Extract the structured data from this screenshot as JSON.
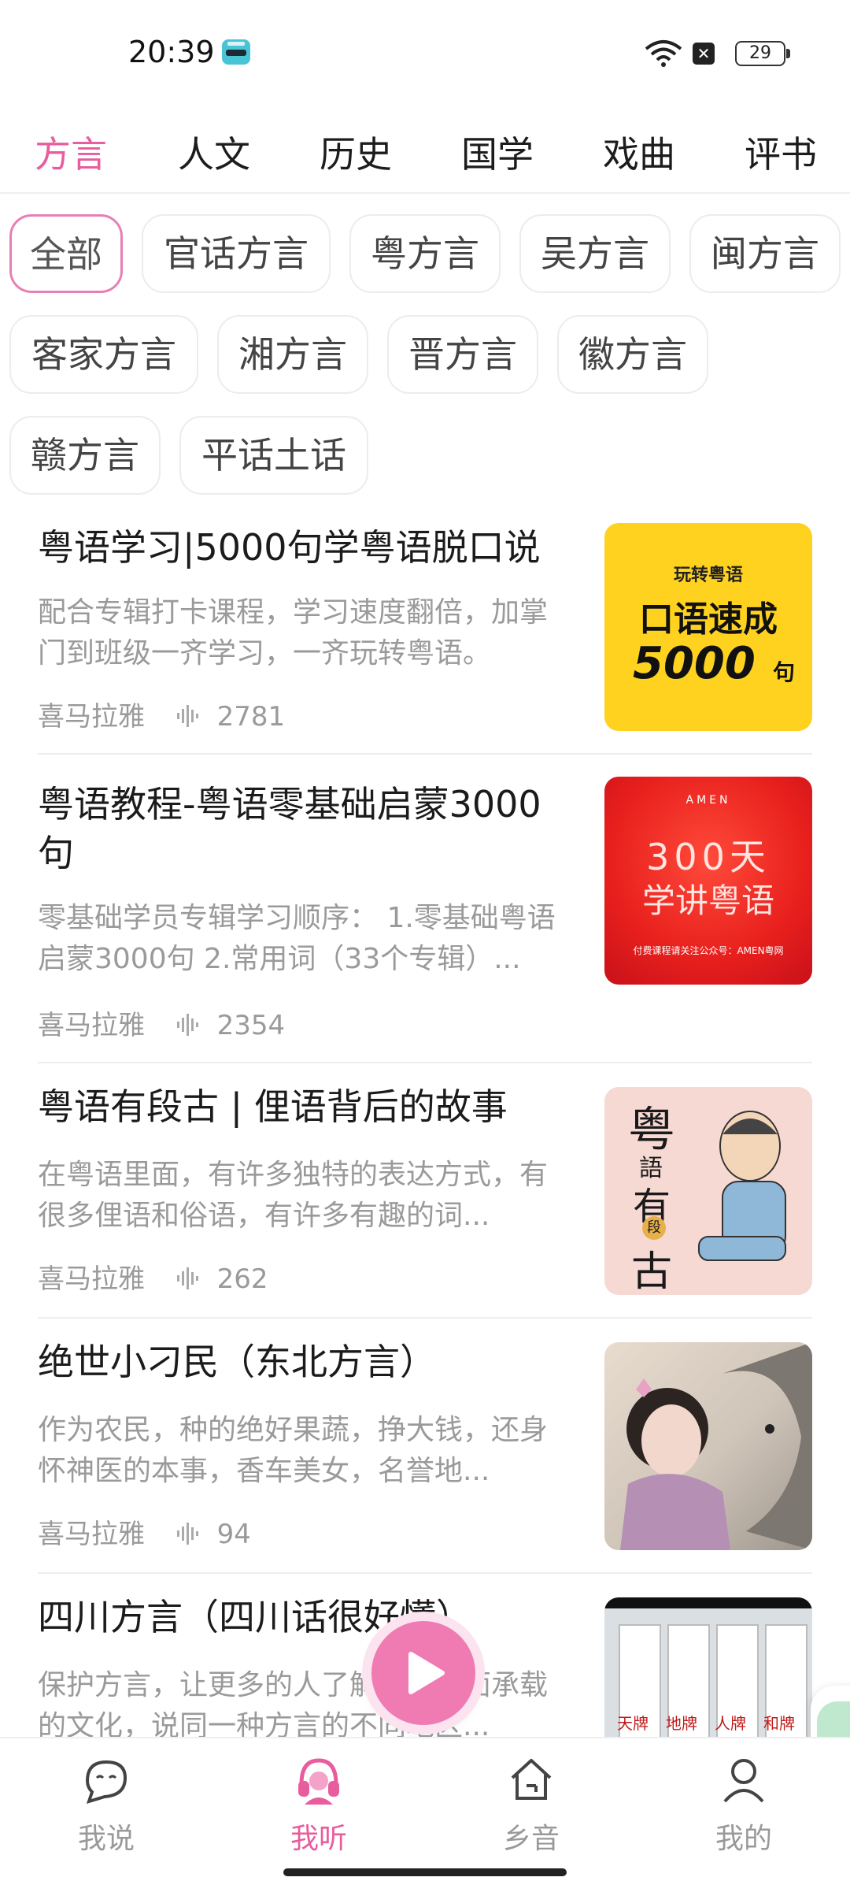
{
  "status_bar": {
    "time": "20:39",
    "battery": "29"
  },
  "tabs": [
    {
      "label": "方言",
      "active": true
    },
    {
      "label": "人文"
    },
    {
      "label": "历史"
    },
    {
      "label": "国学"
    },
    {
      "label": "戏曲"
    },
    {
      "label": "评书"
    }
  ],
  "filters": [
    {
      "label": "全部",
      "active": true
    },
    {
      "label": "官话方言"
    },
    {
      "label": "粤方言"
    },
    {
      "label": "吴方言"
    },
    {
      "label": "闽方言"
    },
    {
      "label": "客家方言"
    },
    {
      "label": "湘方言"
    },
    {
      "label": "晋方言"
    },
    {
      "label": "徽方言"
    },
    {
      "label": "赣方言"
    },
    {
      "label": "平话土话"
    }
  ],
  "items": [
    {
      "title": "粤语学习|5000句学粤语脱口说",
      "desc": "配合专辑打卡课程，学习速度翻倍，加掌门到班级一齐学习，一齐玩转粤语。",
      "source": "喜马拉雅",
      "plays": "2781",
      "cover": {
        "top": "玩转粤语",
        "main": "口语速成",
        "num": "5000",
        "unit": "句"
      }
    },
    {
      "title": "粤语教程-粤语零基础启蒙3000句",
      "desc": "零基础学员专辑学习顺序： 1.零基础粤语启蒙3000句 2.常用词（33个专辑）...",
      "source": "喜马拉雅",
      "plays": "2354",
      "cover": {
        "top": "AMEN",
        "line1": "300天",
        "line2": "学讲粤语",
        "foot": "付费课程请关注公众号：AMEN粤网"
      }
    },
    {
      "title": "粤语有段古 | 俚语背后的故事",
      "desc": "在粤语里面，有许多独特的表达方式，有很多俚语和俗语，有许多有趣的词...",
      "source": "喜马拉雅",
      "plays": "262",
      "cover": {
        "c1": "粤",
        "c2": "語",
        "c3": "有",
        "c4": "段",
        "c5": "古"
      }
    },
    {
      "title": "绝世小刁民（东北方言）",
      "desc": "作为农民，种的绝好果蔬，挣大钱，还身怀神医的本事，香车美女，名誉地...",
      "source": "喜马拉雅",
      "plays": "94"
    },
    {
      "title": "四川方言（四川话很好懂）",
      "desc": "保护方言，让更多的人了解方言里面承载的文化，说同一种方言的不同地区...",
      "cover": {
        "t1": "天牌",
        "t2": "地牌",
        "t3": "人牌",
        "t4": "和牌"
      }
    }
  ],
  "bottom_nav": [
    {
      "label": "我说",
      "icon": "chat-face-icon"
    },
    {
      "label": "我听",
      "icon": "headphones-icon",
      "active": true
    },
    {
      "label": "乡音",
      "icon": "home-icon"
    },
    {
      "label": "我的",
      "icon": "profile-icon"
    }
  ],
  "colors": {
    "accent": "#e85d9e"
  }
}
